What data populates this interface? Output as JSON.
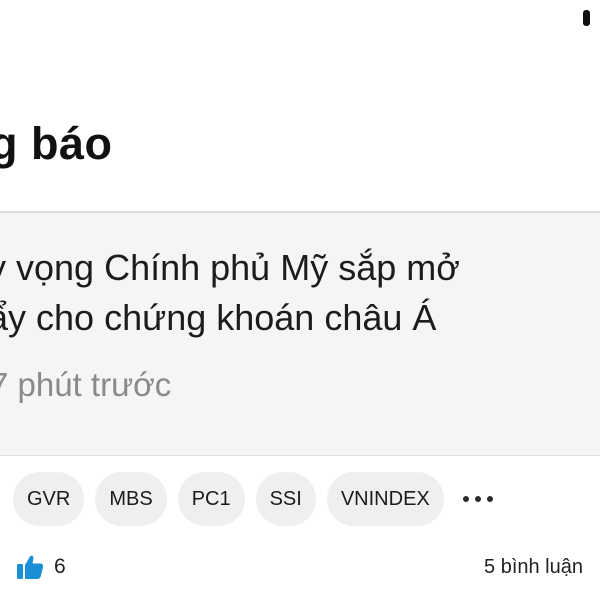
{
  "header": {
    "title": "g báo"
  },
  "news": {
    "headline_line1": "y vọng Chính phủ Mỹ sắp mở",
    "headline_line2": "ẩy cho chứng khoán châu Á",
    "time": "7 phút trước"
  },
  "tags": [
    {
      "label": "GVR"
    },
    {
      "label": "MBS"
    },
    {
      "label": "PC1"
    },
    {
      "label": "SSI"
    },
    {
      "label": "VNINDEX"
    }
  ],
  "footer": {
    "like_count": "6",
    "comments_label": "5 bình luận",
    "like_icon": "thumbs-up-icon",
    "accent_color": "#1a8fd6"
  }
}
